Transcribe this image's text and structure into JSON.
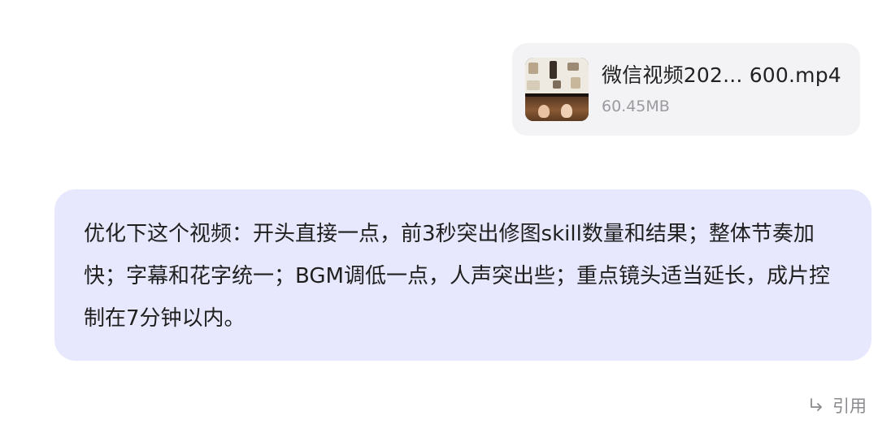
{
  "attachment": {
    "file_name": "微信视频202... 600.mp4",
    "file_size": "60.45MB",
    "thumbnail_icon": "video-thumbnail"
  },
  "message": {
    "text": "优化下这个视频：开头直接一点，前3秒突出修图skill数量和结果；整体节奏加快；字幕和花字统一；BGM调低一点，人声突出些；重点镜头适当延长，成片控制在7分钟以内。",
    "bubble_color": "#e7e8fd"
  },
  "actions": {
    "quote_label": "引用",
    "quote_icon": "reply-arrow-icon"
  }
}
